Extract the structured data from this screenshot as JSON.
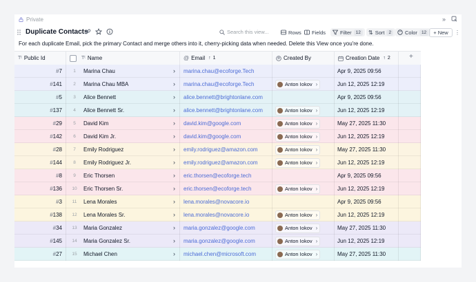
{
  "header": {
    "privacy_label": "Private",
    "title": "Duplicate Contacts",
    "description": "For each duplicate Email, pick the primary Contact and merge others into it, cherry-picking data when needed. Delete this View once you're done."
  },
  "toolbar": {
    "search_placeholder": "Search this view...",
    "rows_label": "Rows",
    "fields_label": "Fields",
    "filter_label": "Filter",
    "filter_count": "12",
    "sort_label": "Sort",
    "sort_count": "2",
    "color_label": "Color",
    "color_count": "12",
    "new_label": "New"
  },
  "columns": {
    "public_id": "Public Id",
    "name": "Name",
    "email": "Email",
    "email_sort": "1",
    "created_by": "Created By",
    "creation_date": "Creation Date",
    "creation_date_sort": "2"
  },
  "row_colors": [
    "#eceefb",
    "#e3f2f6",
    "#fbe6eb",
    "#fcf4e2",
    "#fbe6eb",
    "#fcf5df",
    "#ece9f8",
    "#e2f4f6"
  ],
  "rows": [
    {
      "id": "7",
      "rownum": "1",
      "name": "Marina Chau",
      "email": "marina.chau@ecoforge.Tech",
      "created_by": "",
      "date": "Apr 9, 2025 09:56"
    },
    {
      "id": "141",
      "rownum": "2",
      "name": "Marina Chau MBA",
      "email": "marina.chau@ecoforge.Tech",
      "created_by": "Anton Iokov",
      "date": "Jun 12, 2025 12:19"
    },
    {
      "id": "5",
      "rownum": "3",
      "name": "Alice Bennett",
      "email": "alice.bennett@brightonlane.com",
      "created_by": "",
      "date": "Apr 9, 2025 09:56"
    },
    {
      "id": "137",
      "rownum": "4",
      "name": "Alice Bennett Sr.",
      "email": "alice.bennett@brightonlane.com",
      "created_by": "Anton Iokov",
      "date": "Jun 12, 2025 12:19"
    },
    {
      "id": "29",
      "rownum": "5",
      "name": "David Kim",
      "email": "david.kim@google.com",
      "created_by": "Anton Iokov",
      "date": "May 27, 2025 11:30"
    },
    {
      "id": "142",
      "rownum": "6",
      "name": "David Kim Jr.",
      "email": "david.kim@google.com",
      "created_by": "Anton Iokov",
      "date": "Jun 12, 2025 12:19"
    },
    {
      "id": "28",
      "rownum": "7",
      "name": "Emily Rodriguez",
      "email": "emily.rodriguez@amazon.com",
      "created_by": "Anton Iokov",
      "date": "May 27, 2025 11:30"
    },
    {
      "id": "144",
      "rownum": "8",
      "name": "Emily Rodriguez Jr.",
      "email": "emily.rodriguez@amazon.com",
      "created_by": "Anton Iokov",
      "date": "Jun 12, 2025 12:19"
    },
    {
      "id": "8",
      "rownum": "9",
      "name": "Eric Thorsen",
      "email": "eric.thorsen@ecoforge.tech",
      "created_by": "",
      "date": "Apr 9, 2025 09:56"
    },
    {
      "id": "136",
      "rownum": "10",
      "name": "Eric Thorsen Sr.",
      "email": "eric.thorsen@ecoforge.tech",
      "created_by": "Anton Iokov",
      "date": "Jun 12, 2025 12:19"
    },
    {
      "id": "3",
      "rownum": "11",
      "name": "Lena Morales",
      "email": "lena.morales@novacore.io",
      "created_by": "",
      "date": "Apr 9, 2025 09:56"
    },
    {
      "id": "138",
      "rownum": "12",
      "name": "Lena Morales Sr.",
      "email": "lena.morales@novacore.io",
      "created_by": "Anton Iokov",
      "date": "Jun 12, 2025 12:19"
    },
    {
      "id": "34",
      "rownum": "13",
      "name": "Maria Gonzalez",
      "email": "maria.gonzalez@google.com",
      "created_by": "Anton Iokov",
      "date": "May 27, 2025 11:30"
    },
    {
      "id": "145",
      "rownum": "14",
      "name": "Maria Gonzalez Sr.",
      "email": "maria.gonzalez@google.com",
      "created_by": "Anton Iokov",
      "date": "Jun 12, 2025 12:19"
    },
    {
      "id": "27",
      "rownum": "15",
      "name": "Michael Chen",
      "email": "michael.chen@microsoft.com",
      "created_by": "Anton Iokov",
      "date": "May 27, 2025 11:30"
    }
  ]
}
